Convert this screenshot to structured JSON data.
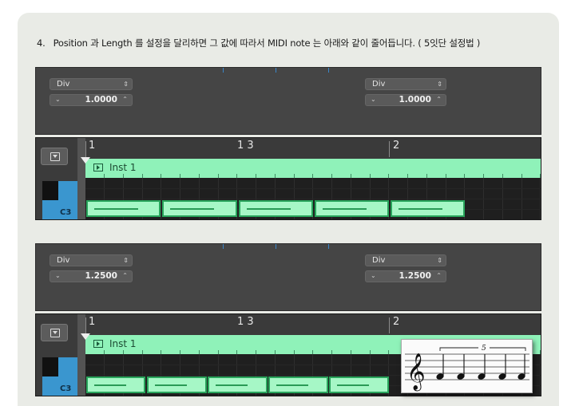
{
  "heading": {
    "number": "4.",
    "text": "Position 과 Length 를 설정을 달리하면 그 값에 따라서 MIDI note 는 아래와 같이 줄어듭니다. ( 5잇단 설정법 )"
  },
  "sections": [
    {
      "panel": {
        "left_dropdown": "Div",
        "left_value": "1.0000",
        "right_dropdown": "Div",
        "right_value": "1.0000"
      },
      "editor": {
        "ruler_marks": [
          "1",
          "1 3",
          "2"
        ],
        "region_name": "Inst 1",
        "key_label": "C3",
        "notes": 5
      }
    },
    {
      "panel": {
        "left_dropdown": "Div",
        "left_value": "1.2500",
        "right_dropdown": "Div",
        "right_value": "1.2500"
      },
      "editor": {
        "ruler_marks": [
          "1",
          "1 3",
          "2"
        ],
        "region_name": "Inst 1",
        "key_label": "C3",
        "notes": 5
      },
      "score": {
        "tuplet_label": "5"
      }
    }
  ],
  "icons": {
    "dropdown": "updown-arrows-icon",
    "stepper": "chevron-icon",
    "region": "play-icon",
    "collapse": "collapse-icon",
    "clef": "treble-clef-icon"
  },
  "colors": {
    "region": "#8ff2b9",
    "note": "#a6f7c6",
    "note_border": "#29a55c",
    "key": "#3a96cf",
    "panel": "#454545"
  }
}
